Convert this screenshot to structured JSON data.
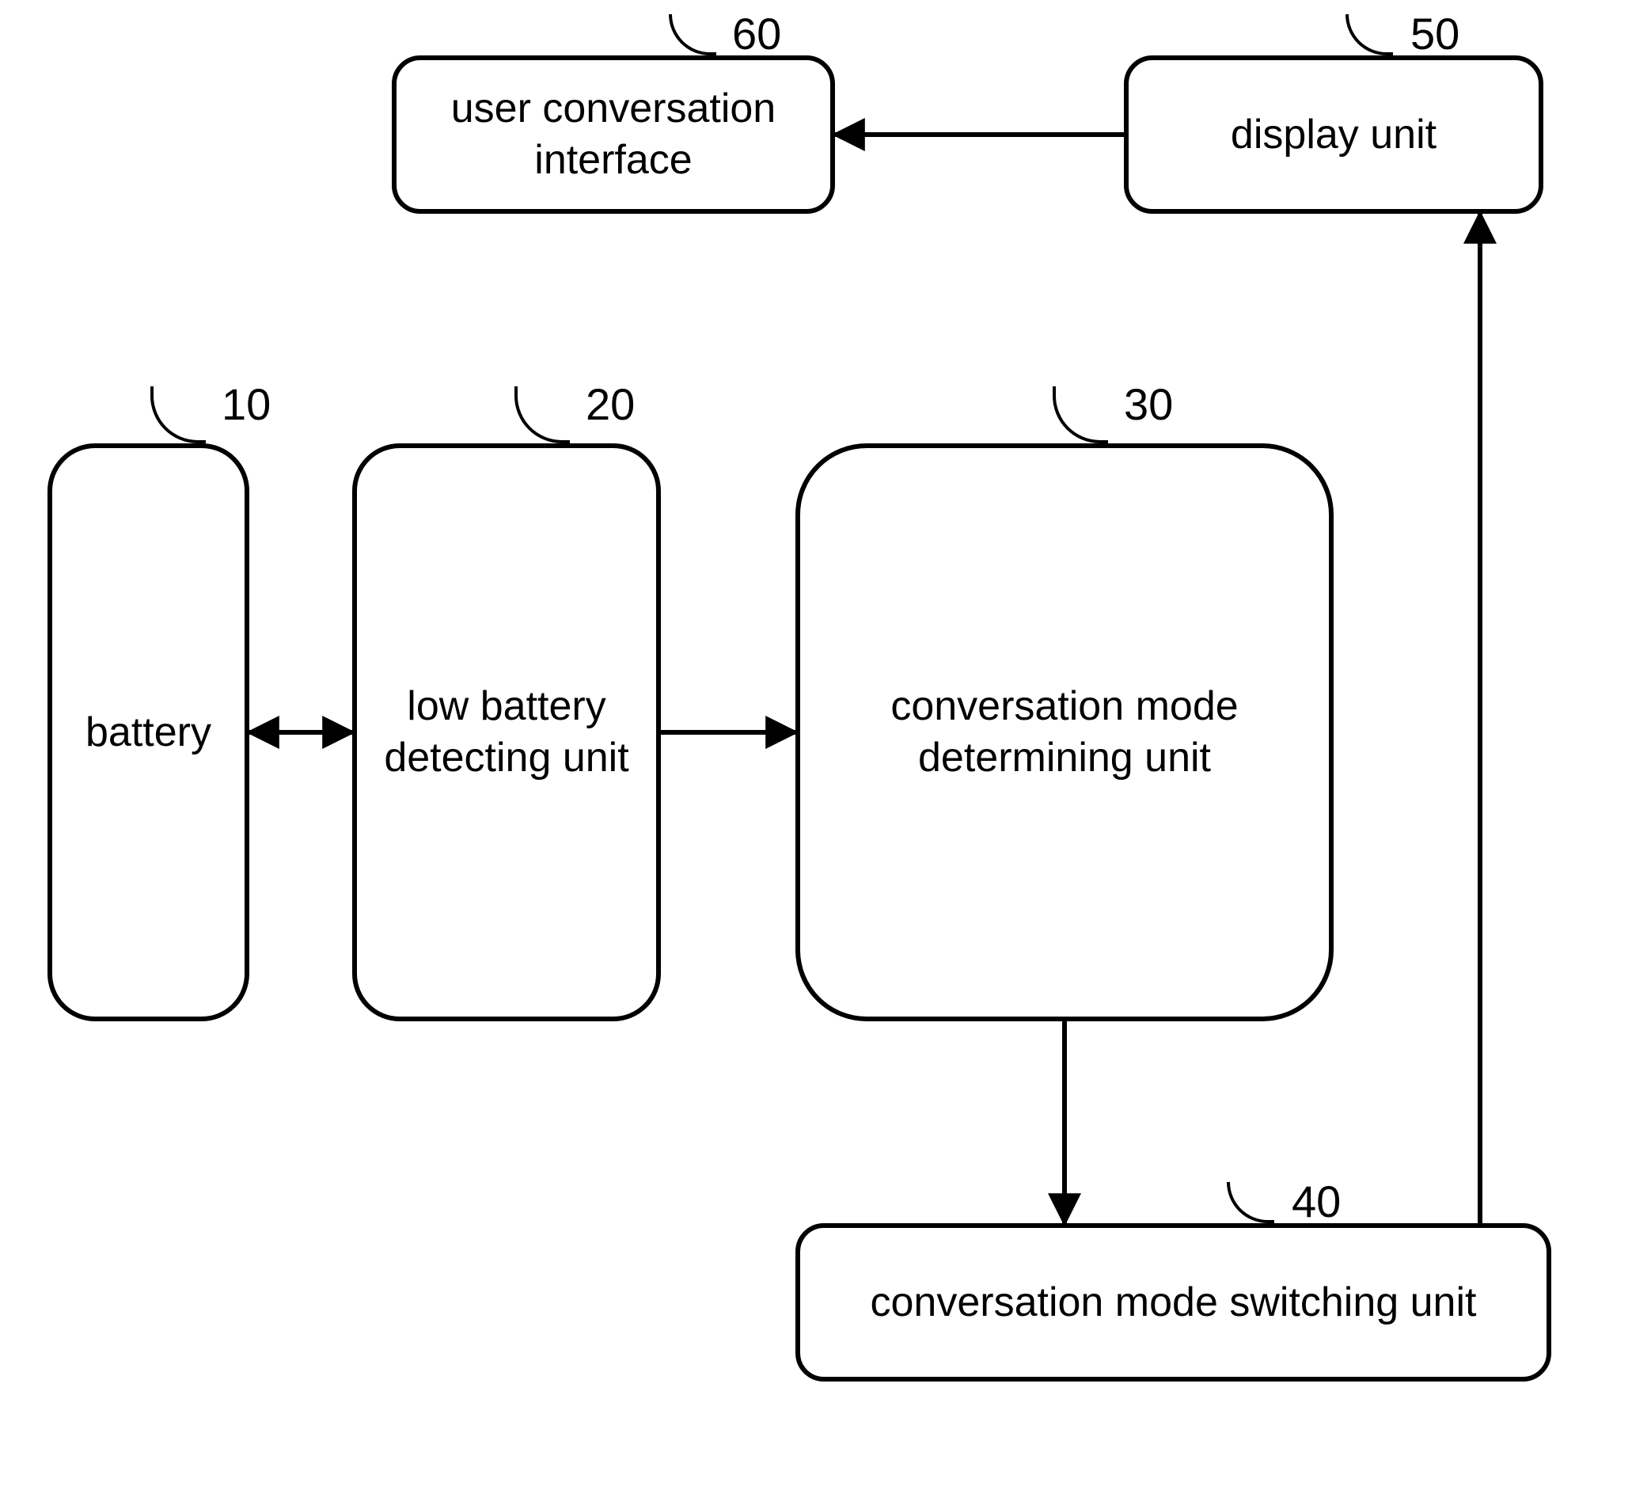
{
  "blocks": {
    "battery": {
      "label": "battery",
      "ref": "10"
    },
    "detector": {
      "label": "low battery detecting unit",
      "ref": "20"
    },
    "determine": {
      "label": "conversation mode determining unit",
      "ref": "30"
    },
    "switching": {
      "label": "conversation mode switching unit",
      "ref": "40"
    },
    "display": {
      "label": "display unit",
      "ref": "50"
    },
    "uci": {
      "label": "user conversation interface",
      "ref": "60"
    }
  }
}
